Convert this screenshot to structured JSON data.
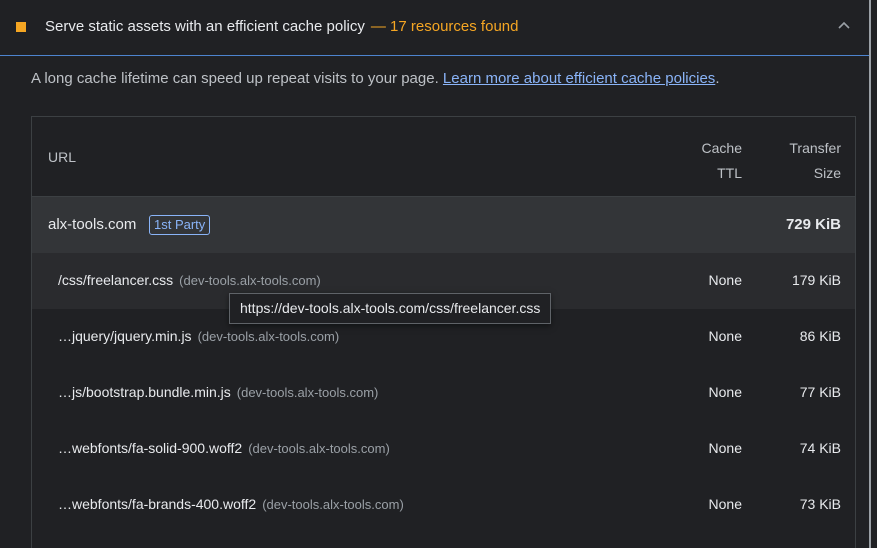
{
  "audit": {
    "title": "Serve static assets with an efficient cache policy",
    "summary": "— 17 resources found",
    "status_color": "#f5a623"
  },
  "description": {
    "text": "A long cache lifetime can speed up repeat visits to your page. ",
    "link_text": "Learn more about efficient cache policies",
    "trailing": "."
  },
  "table": {
    "headers": {
      "url": "URL",
      "cache_ttl_line1": "Cache",
      "cache_ttl_line2": "TTL",
      "size_line1": "Transfer",
      "size_line2": "Size"
    },
    "group": {
      "entity": "alx-tools.com",
      "badge": "1st Party",
      "size": "729 KiB"
    },
    "rows": [
      {
        "url": "/css/freelancer.css",
        "host": "(dev-tools.alx-tools.com)",
        "ttl": "None",
        "size": "179 KiB"
      },
      {
        "url": "…jquery/jquery.min.js",
        "host": "(dev-tools.alx-tools.com)",
        "ttl": "None",
        "size": "86 KiB"
      },
      {
        "url": "…js/bootstrap.bundle.min.js",
        "host": "(dev-tools.alx-tools.com)",
        "ttl": "None",
        "size": "77 KiB"
      },
      {
        "url": "…webfonts/fa-solid-900.woff2",
        "host": "(dev-tools.alx-tools.com)",
        "ttl": "None",
        "size": "74 KiB"
      },
      {
        "url": "…webfonts/fa-brands-400.woff2",
        "host": "(dev-tools.alx-tools.com)",
        "ttl": "None",
        "size": "73 KiB"
      }
    ]
  },
  "tooltip": {
    "text": "https://dev-tools.alx-tools.com/css/freelancer.css"
  },
  "icons": {
    "collapse": "chevron-up-icon",
    "status": "fail-square-icon"
  }
}
